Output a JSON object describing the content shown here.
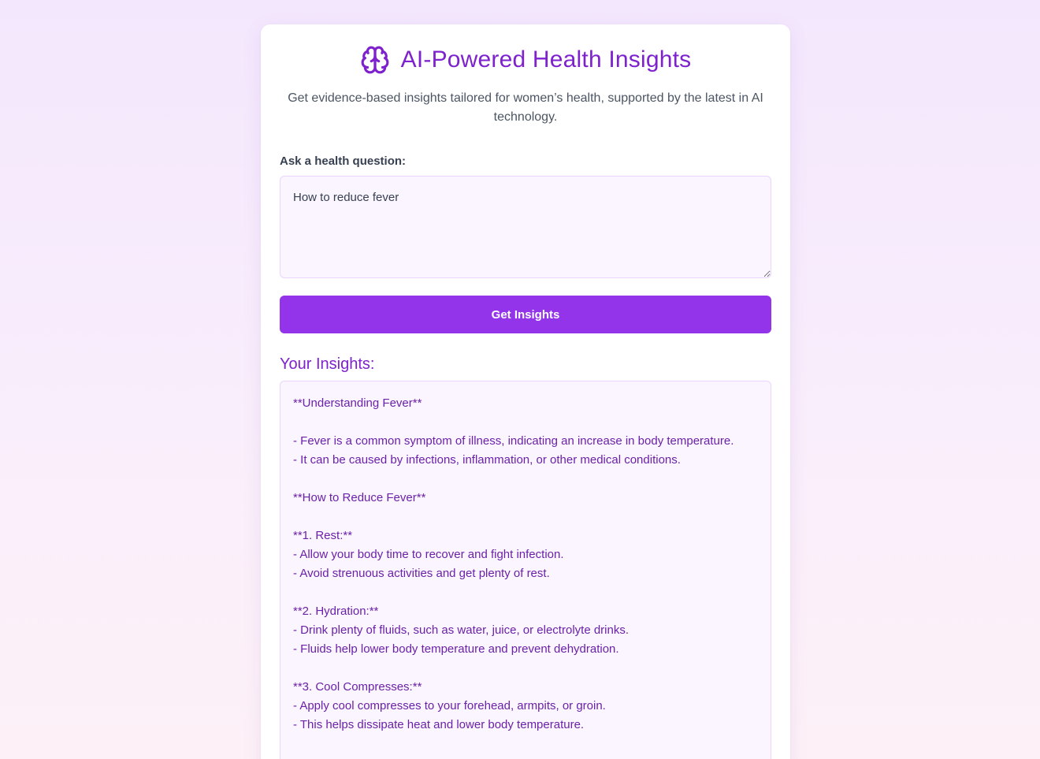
{
  "header": {
    "title": "AI-Powered Health Insights",
    "icon": "brain-icon",
    "accent_color": "#7e22ce"
  },
  "intro": {
    "subtitle": "Get evidence-based insights tailored for women’s health, supported by the latest in AI technology."
  },
  "question": {
    "label": "Ask a health question:",
    "value": "How to reduce fever"
  },
  "actions": {
    "get_insights_label": "Get Insights",
    "button_color": "#9333ea"
  },
  "insights": {
    "heading": "Your Insights:",
    "lines": [
      "**Understanding Fever**",
      "",
      "- Fever is a common symptom of illness, indicating an increase in body temperature.",
      "- It can be caused by infections, inflammation, or other medical conditions.",
      "",
      "**How to Reduce Fever**",
      "",
      "**1. Rest:**",
      "- Allow your body time to recover and fight infection.",
      "- Avoid strenuous activities and get plenty of rest.",
      "",
      "**2. Hydration:**",
      "- Drink plenty of fluids, such as water, juice, or electrolyte drinks.",
      "- Fluids help lower body temperature and prevent dehydration.",
      "",
      "**3. Cool Compresses:**",
      "- Apply cool compresses to your forehead, armpits, or groin.",
      "- This helps dissipate heat and lower body temperature."
    ]
  }
}
